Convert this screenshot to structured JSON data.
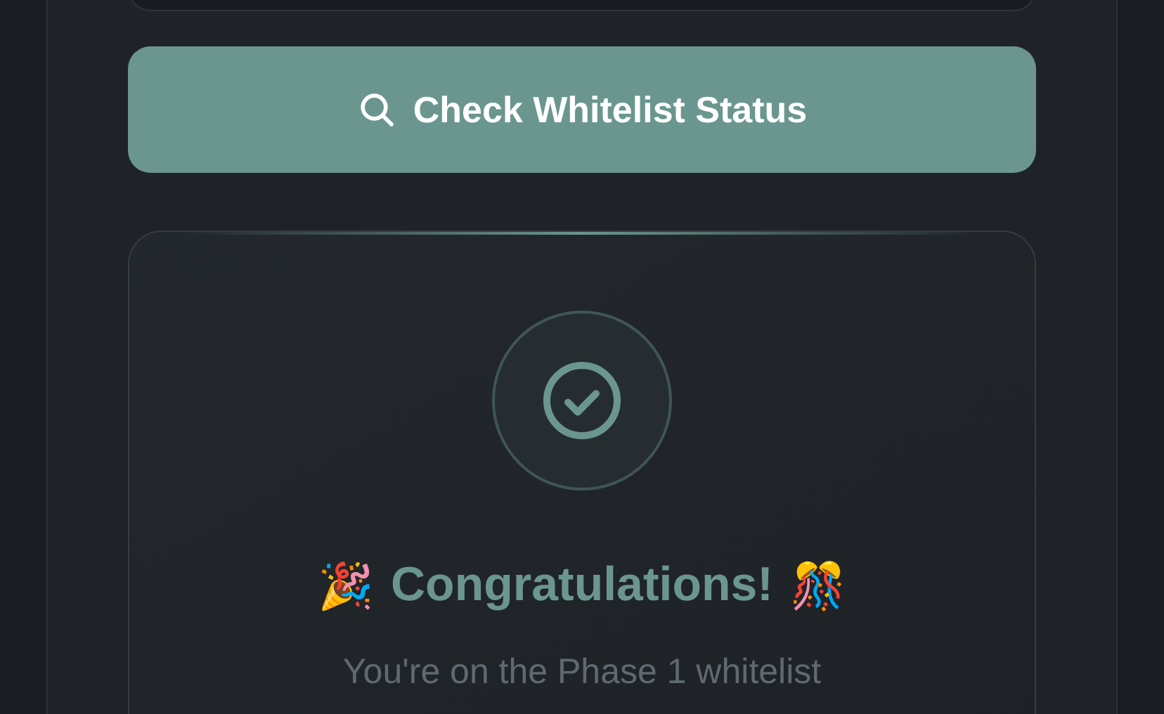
{
  "check_button": {
    "label": "Check Whitelist Status"
  },
  "result": {
    "verified": true,
    "emoji_left": "🎉",
    "title": "Congratulations!",
    "emoji_right": "🎊",
    "message": "You're on the Phase 1 whitelist"
  }
}
